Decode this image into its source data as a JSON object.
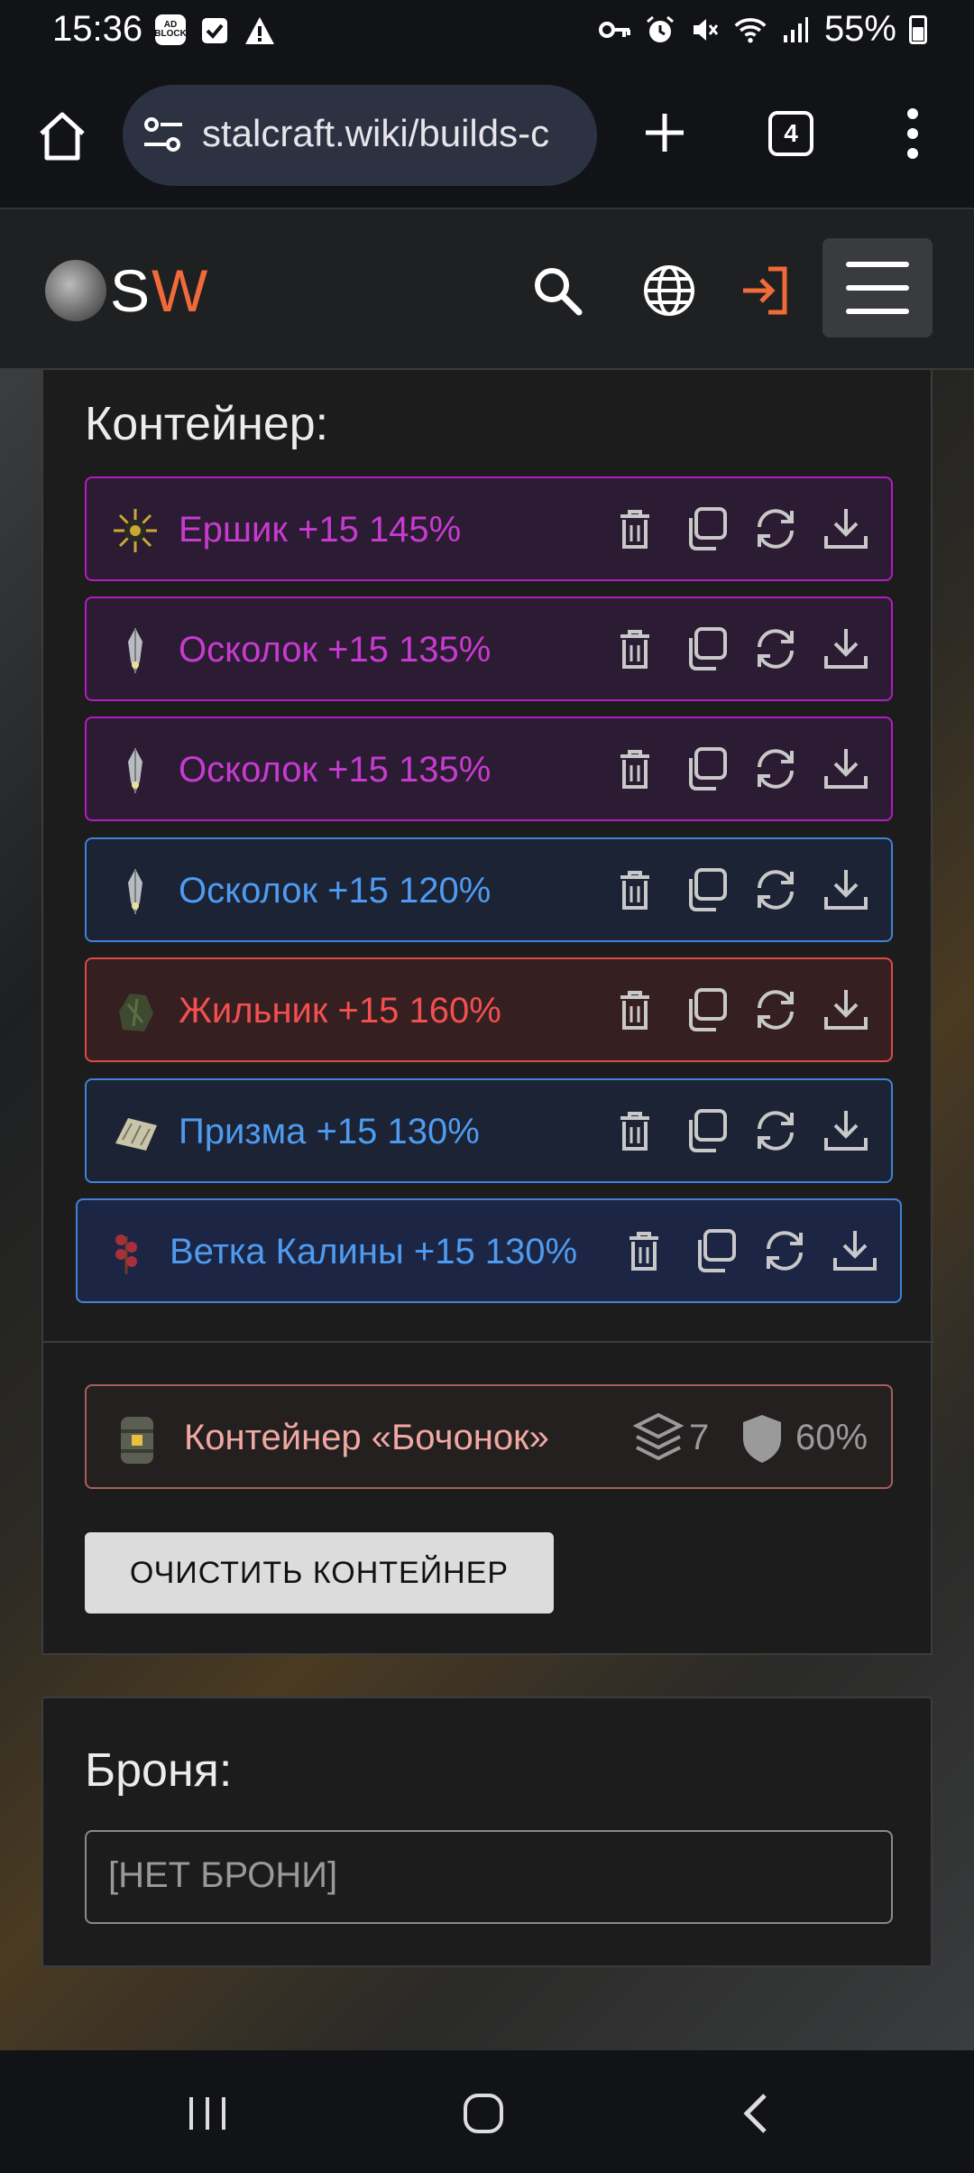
{
  "status_bar": {
    "time": "15:36",
    "adblock_badge": "AD BLOCK",
    "battery": "55%",
    "icons": [
      "adblock-icon",
      "check-icon",
      "warning-icon",
      "key-icon",
      "alarm-icon",
      "mute-icon",
      "wifi-icon",
      "signal-icon",
      "battery-icon"
    ]
  },
  "browser": {
    "url": "stalcraft.wiki/builds-c",
    "tab_count": "4"
  },
  "site": {
    "logo_s": "S",
    "logo_w": "W",
    "colors": {
      "accent": "#f06a3a"
    }
  },
  "container_section": {
    "title": "Контейнер:",
    "items": [
      {
        "label": "Ершик +15 145%",
        "rarity": "purple",
        "icon": "ershik-artifact-icon"
      },
      {
        "label": "Осколок +15 135%",
        "rarity": "purple",
        "icon": "oskolok-artifact-icon"
      },
      {
        "label": "Осколок +15 135%",
        "rarity": "purple",
        "icon": "oskolok-artifact-icon"
      },
      {
        "label": "Осколок +15 120%",
        "rarity": "blue",
        "icon": "oskolok-artifact-icon"
      },
      {
        "label": "Жильник +15 160%",
        "rarity": "red",
        "icon": "zhilnik-artifact-icon"
      },
      {
        "label": "Призма +15 130%",
        "rarity": "blue",
        "icon": "prizma-artifact-icon"
      },
      {
        "label": "Ветка Калины +15 130%",
        "rarity": "navy",
        "icon": "vetka-kaliny-artifact-icon"
      }
    ],
    "container": {
      "label": "Контейнер «Бочонок»",
      "slots": "7",
      "protection": "60%"
    },
    "clear_button": "ОЧИСТИТЬ КОНТЕЙНЕР"
  },
  "armor_section": {
    "title": "Броня:",
    "value": "[НЕТ БРОНИ]"
  }
}
